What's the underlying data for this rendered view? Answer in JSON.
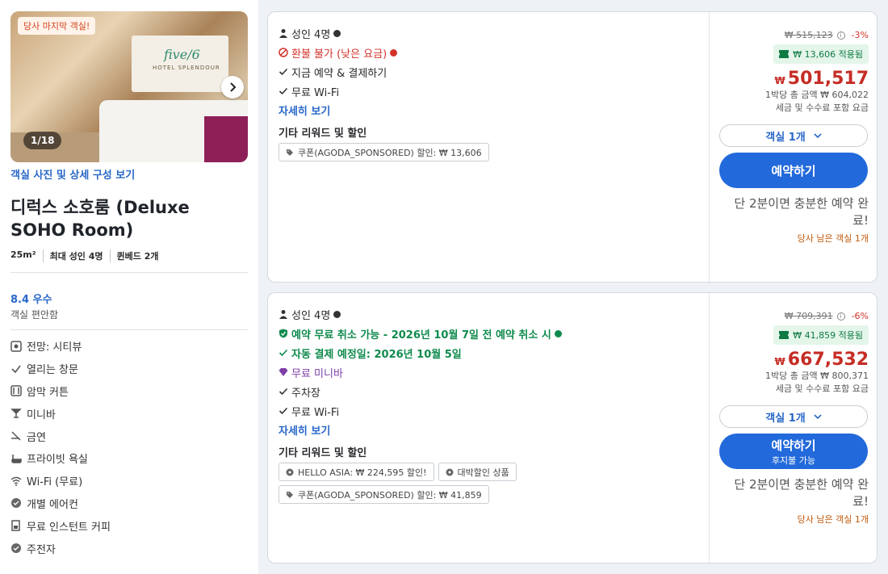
{
  "room": {
    "badge": "당사 마지막 객실!",
    "photo_counter": "1/18",
    "photo_logo": "five/6",
    "photo_logo_sub": "HOTEL SPLENDOUR",
    "photos_link": "객실 사진 및 상세 구성 보기",
    "title": "디럭스 소호룸 (Deluxe SOHO Room)",
    "meta": [
      "25m²",
      "최대 성인 4명",
      "퀸베드 2개"
    ],
    "score": "8.4 우수",
    "score_sub": "객실 편안함",
    "amenities": [
      {
        "icon": "view-icon",
        "label": "전망: 시티뷰"
      },
      {
        "icon": "check-icon",
        "label": "열리는 창문"
      },
      {
        "icon": "curtain-icon",
        "label": "암막 커튼"
      },
      {
        "icon": "minibar-icon",
        "label": "미니바"
      },
      {
        "icon": "no-smoking-icon",
        "label": "금연"
      },
      {
        "icon": "bath-icon",
        "label": "프라이빗 욕실"
      },
      {
        "icon": "wifi-icon",
        "label": "Wi-Fi (무료)"
      },
      {
        "icon": "aircon-icon",
        "label": "개별 에어컨"
      },
      {
        "icon": "coffee-icon",
        "label": "무료 인스턴트 커피"
      },
      {
        "icon": "bike-icon",
        "label": "주전자"
      }
    ]
  },
  "offers": [
    {
      "guests": "성인 4명",
      "policy": "환불 불가 (낮은 요금)",
      "features": [
        "지금 예약 & 결제하기",
        "무료 Wi-Fi"
      ],
      "more": "자세히 보기",
      "rewards_title": "기타 리워드 및 할인",
      "chips": [
        "쿠폰(AGODA_SPONSORED) 할인: ₩ 13,606"
      ],
      "original_price": "₩ 515,123",
      "discount_pct": "-3%",
      "applied": "₩ 13,606 적용됨",
      "currency": "₩",
      "price": "501,517",
      "total": "1박당 총 금액 ₩ 604,022",
      "tax_note": "세금 및 수수료 포함 요금",
      "qty": "객실 1개",
      "book": "예약하기",
      "book_sub": "",
      "quick": "단 2분이면 충분한 예약 완료!",
      "left": "당사 남은 객실 1개"
    },
    {
      "guests": "성인 4명",
      "policy": "예약 무료 취소 가능 - 2026년 10월 7일 전 예약 취소 시",
      "autopay": "자동 결제 예정일: 2026년 10월 5일",
      "minibar": "무료 미니바",
      "features": [
        "주차장",
        "무료 Wi-Fi"
      ],
      "more": "자세히 보기",
      "rewards_title": "기타 리워드 및 할인",
      "chips": [
        "HELLO ASIA: ₩ 224,595 할인!",
        "대박할인 상품",
        "쿠폰(AGODA_SPONSORED) 할인: ₩ 41,859"
      ],
      "original_price": "₩ 709,391",
      "discount_pct": "-6%",
      "applied": "₩ 41,859 적용됨",
      "currency": "₩",
      "price": "667,532",
      "total": "1박당 총 금액 ₩ 800,371",
      "tax_note": "세금 및 수수료 포함 요금",
      "qty": "객실 1개",
      "book": "예약하기",
      "book_sub": "후지불 가능",
      "quick": "단 2분이면 충분한 예약 완료!",
      "left": "당사 남은 객실 1개"
    }
  ],
  "colors": {
    "accent": "#2269db",
    "price": "#c52d25",
    "green": "#0f8a4d",
    "link": "#2867c7"
  }
}
